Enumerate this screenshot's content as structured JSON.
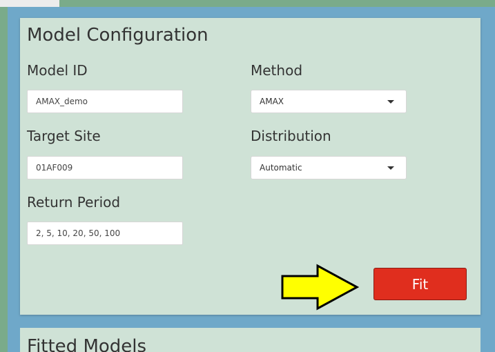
{
  "config": {
    "title": "Model Configuration",
    "model_id": {
      "label": "Model ID",
      "value": "AMAX_demo"
    },
    "method": {
      "label": "Method",
      "value": "AMAX"
    },
    "target_site": {
      "label": "Target Site",
      "value": "01AF009"
    },
    "distribution": {
      "label": "Distribution",
      "value": "Automatic"
    },
    "return_period": {
      "label": "Return Period",
      "value": "2, 5, 10, 20, 50, 100"
    },
    "fit_label": "Fit"
  },
  "fitted": {
    "title": "Fitted Models"
  },
  "colors": {
    "panel_background": "#cfe2d6",
    "frame_blue": "#6fa8c9",
    "outer_green": "#7aab8a",
    "fit_button": "#e02e1e",
    "arrow_fill": "#ffff00"
  },
  "icons": {
    "dropdown": "caret-down-icon",
    "pointer": "arrow-right-icon"
  }
}
